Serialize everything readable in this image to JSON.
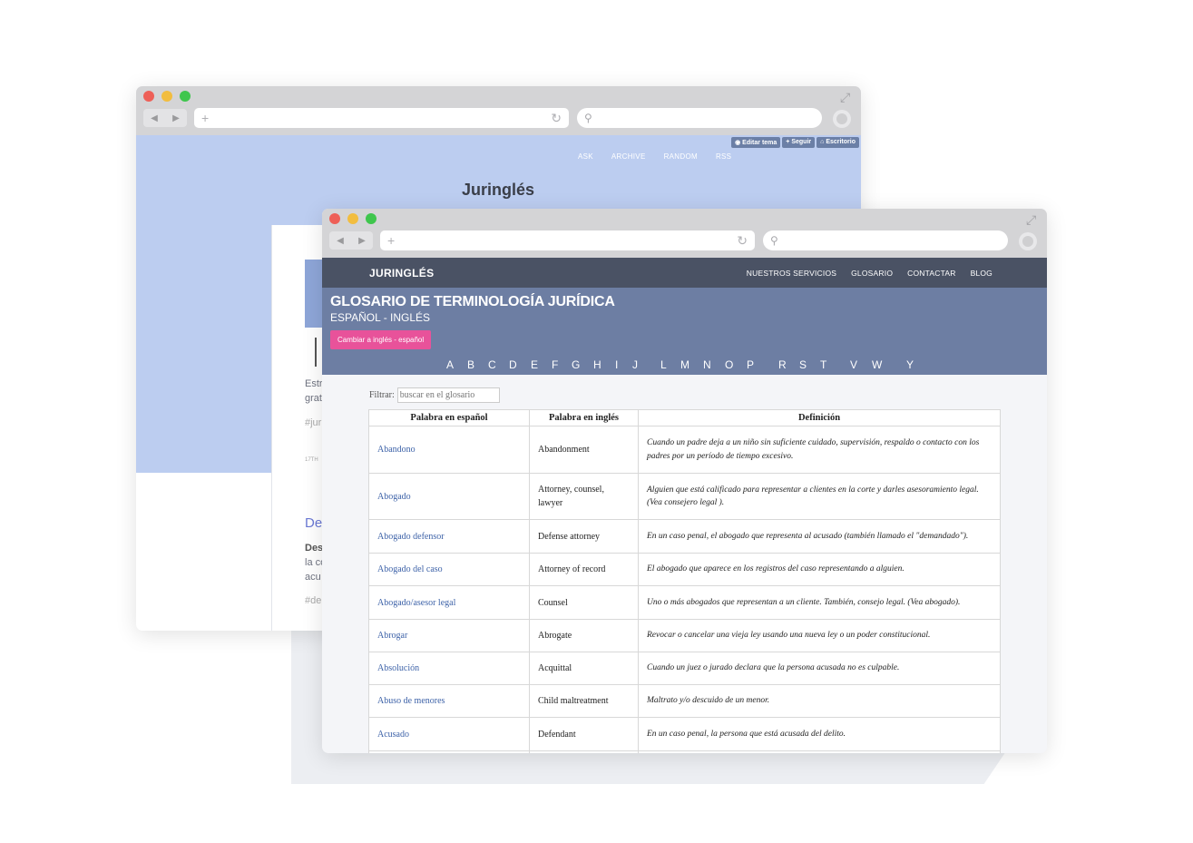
{
  "back_window": {
    "tumblr_controls": [
      "Editar tema",
      "Seguir",
      "Escritorio"
    ],
    "nav": [
      "ASK",
      "ARCHIVE",
      "RANDOM",
      "RSS"
    ],
    "blog_title": "Juringlés",
    "post_fragments": [
      "Estr",
      "grat",
      "#jur",
      "17TH",
      "De",
      "Des",
      "la co",
      "acu",
      "#de"
    ]
  },
  "front_window": {
    "brand": "JURINGLÉS",
    "menu": [
      "NUESTROS SERVICIOS",
      "GLOSARIO",
      "CONTACTAR",
      "BLOG"
    ],
    "title": "GLOSARIO DE TERMINOLOGÍA JURÍDICA",
    "subtitle": "ESPAÑOL - INGLÉS",
    "switch_button": "Cambiar a inglés - español",
    "alphabet": [
      "A",
      "B",
      "C",
      "D",
      "E",
      "F",
      "G",
      "H",
      "I",
      "J",
      "L",
      "M",
      "N",
      "O",
      "P",
      "R",
      "S",
      "T",
      "V",
      "W",
      "Y"
    ],
    "filter_label": "Filtrar:",
    "filter_placeholder": "buscar en el glosario",
    "table": {
      "headers": [
        "Palabra en español",
        "Palabra en inglés",
        "Definición"
      ],
      "rows": [
        {
          "es": "Abandono",
          "en": "Abandonment",
          "def": "Cuando un padre deja a un niño sin suficiente cuidado, supervisión, respaldo o contacto con los padres por un período de tiempo excesivo."
        },
        {
          "es": "Abogado",
          "en": "Attorney, counsel, lawyer",
          "def": "Alguien que está calificado para representar a clientes en la corte y darles asesoramiento legal. (Vea consejero legal )."
        },
        {
          "es": "Abogado defensor",
          "en": "Defense attorney",
          "def": "En un caso penal, el abogado que representa al acusado (también llamado el \"demandado\")."
        },
        {
          "es": "Abogado del caso",
          "en": "Attorney of record",
          "def": "El abogado que aparece en los registros del caso representando a alguien."
        },
        {
          "es": "Abogado/asesor legal",
          "en": "Counsel",
          "def": "Uno o más abogados que representan a un cliente. También, consejo legal. (Vea abogado)."
        },
        {
          "es": "Abrogar",
          "en": "Abrogate",
          "def": "Revocar o cancelar una vieja ley usando una nueva ley o un poder constitucional."
        },
        {
          "es": "Absolución",
          "en": "Acquittal",
          "def": "Cuando un juez o jurado declara que la persona acusada no es culpable."
        },
        {
          "es": "Abuso de menores",
          "en": "Child maltreatment",
          "def": "Maltrato y/o descuido de un menor."
        },
        {
          "es": "Acusado",
          "en": "Defendant",
          "def": "En un caso penal, la persona que está acusada del delito."
        }
      ]
    }
  },
  "colors": {
    "close": "#ee5f57",
    "minimize": "#f2bd3f",
    "zoom": "#3fc64d",
    "accent_pink": "#e8529a",
    "hero": "#6d7ea3",
    "nav": "#4a5264"
  }
}
